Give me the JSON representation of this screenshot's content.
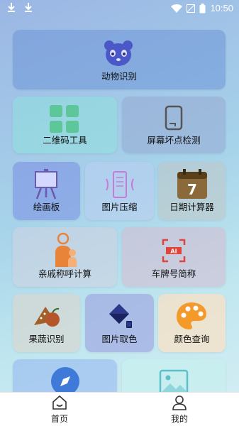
{
  "status_bar": {
    "time": "10:50",
    "icons": [
      "download-icon",
      "download-icon",
      "wifi-icon",
      "no-signal-icon",
      "battery-icon"
    ]
  },
  "tools": {
    "animal": {
      "label": "动物识别",
      "icon": "panda-icon"
    },
    "qr": {
      "label": "二维码工具",
      "icon": "qr-grid-icon"
    },
    "screen": {
      "label": "屏幕坏点检测",
      "icon": "phone-screen-icon"
    },
    "draw": {
      "label": "绘画板",
      "icon": "easel-icon"
    },
    "compress": {
      "label": "图片压缩",
      "icon": "compress-icon"
    },
    "date": {
      "label": "日期计算器",
      "icon": "calendar-icon",
      "day": "7"
    },
    "kin": {
      "label": "亲戚称呼计算",
      "icon": "family-icon"
    },
    "plate": {
      "label": "车牌号简称",
      "icon": "ai-scan-icon",
      "scan_text": "AI"
    },
    "fruit": {
      "label": "果蔬识别",
      "icon": "fruit-icon"
    },
    "pick": {
      "label": "图片取色",
      "icon": "paint-bucket-icon"
    },
    "color": {
      "label": "颜色查询",
      "icon": "palette-icon"
    },
    "compass": {
      "label": "",
      "icon": "compass-icon"
    },
    "image": {
      "label": "",
      "icon": "image-icon"
    }
  },
  "bottom_nav": {
    "home": "首页",
    "mine": "我的"
  },
  "colors": {
    "panda": "#4a58c8",
    "qr": "#5ec79a",
    "calendar": "#6b4a1f",
    "family": "#e8833a",
    "plate": "#e0443a",
    "palette": "#f39a2b"
  }
}
